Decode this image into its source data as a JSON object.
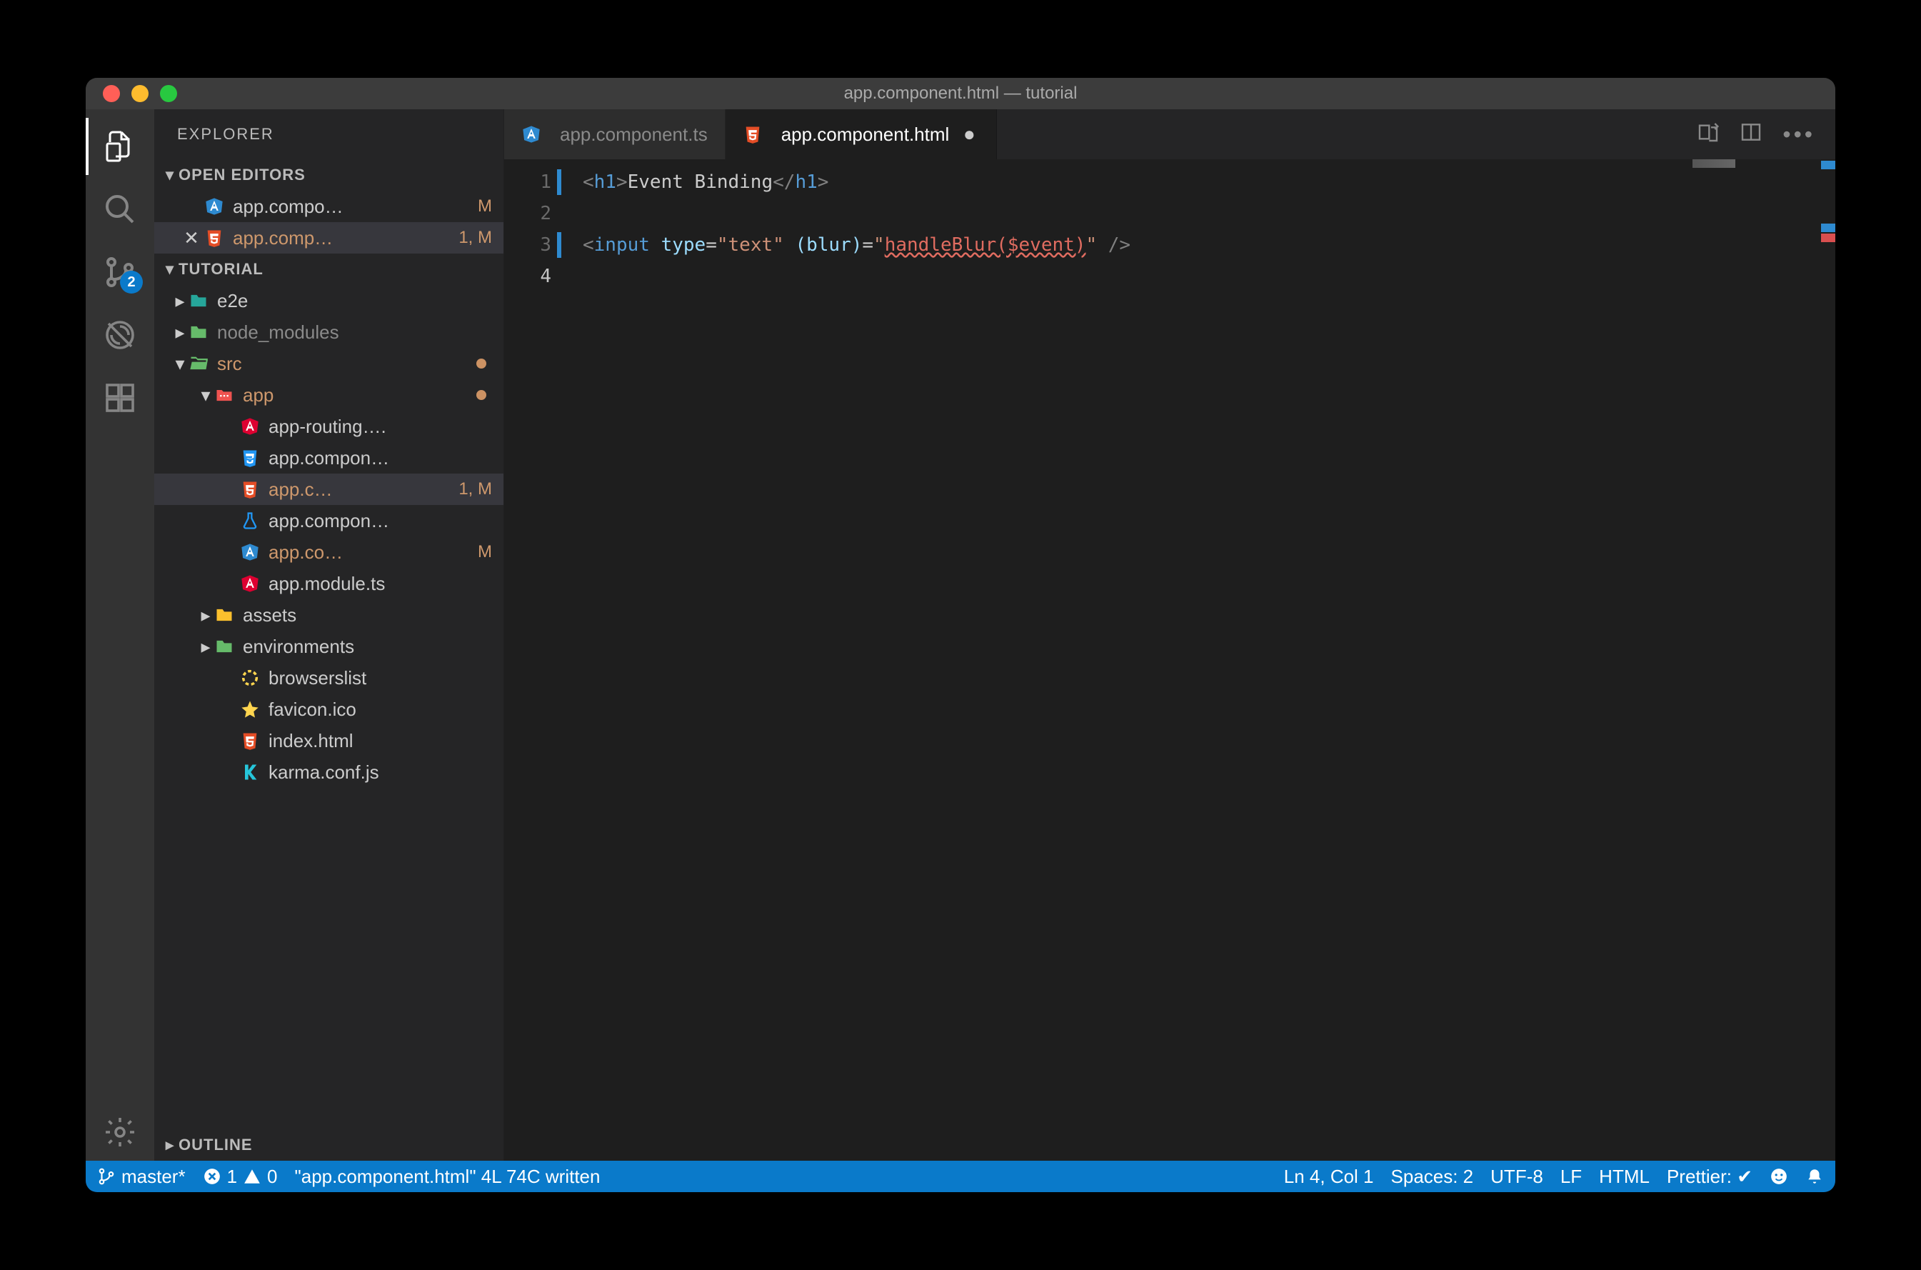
{
  "window": {
    "title": "app.component.html — tutorial"
  },
  "activity": {
    "scm_badge": "2"
  },
  "sidebar": {
    "title": "EXPLORER",
    "sections": {
      "open_editors": "OPEN EDITORS",
      "workspace": "TUTORIAL",
      "outline": "OUTLINE"
    },
    "open_editors": [
      {
        "name": "app.compo…",
        "icon": "angular",
        "badge": "M",
        "active": false
      },
      {
        "name": "app.comp…",
        "icon": "html",
        "badge": "1, M",
        "active": true
      }
    ],
    "tree": [
      {
        "indent": 0,
        "chev": "▸",
        "icon": "folder-teal",
        "label": "e2e"
      },
      {
        "indent": 0,
        "chev": "▸",
        "icon": "folder-dim",
        "label": "node_modules",
        "dim": true
      },
      {
        "indent": 0,
        "chev": "▾",
        "icon": "folder-open",
        "label": "src",
        "mod_dot": true,
        "mod": true
      },
      {
        "indent": 1,
        "chev": "▾",
        "icon": "folder-red",
        "label": "app",
        "mod_dot": true,
        "mod": true
      },
      {
        "indent": 2,
        "icon": "angular",
        "label": "app-routing…."
      },
      {
        "indent": 2,
        "icon": "css",
        "label": "app.compon…"
      },
      {
        "indent": 2,
        "icon": "html",
        "label": "app.c…",
        "badge": "1, M",
        "mod": true,
        "selected": true
      },
      {
        "indent": 2,
        "icon": "flask",
        "label": "app.compon…"
      },
      {
        "indent": 2,
        "icon": "angular-blue",
        "label": "app.co…",
        "badge": "M",
        "mod": true
      },
      {
        "indent": 2,
        "icon": "angular",
        "label": "app.module.ts"
      },
      {
        "indent": 1,
        "chev": "▸",
        "icon": "folder-yellow",
        "label": "assets"
      },
      {
        "indent": 1,
        "chev": "▸",
        "icon": "folder-green",
        "label": "environments"
      },
      {
        "indent": 2,
        "icon": "ring",
        "label": "browserslist"
      },
      {
        "indent": 2,
        "icon": "star",
        "label": "favicon.ico"
      },
      {
        "indent": 2,
        "icon": "html",
        "label": "index.html"
      },
      {
        "indent": 2,
        "icon": "karma",
        "label": "karma.conf.js"
      }
    ]
  },
  "tabs": [
    {
      "icon": "angular-blue",
      "label": "app.component.ts",
      "active": false,
      "close": false
    },
    {
      "icon": "html",
      "label": "app.component.html",
      "active": true,
      "close": true
    }
  ],
  "editor": {
    "lines": [
      "1",
      "2",
      "3",
      "4"
    ],
    "code": {
      "l1_tag_open": "<h1>",
      "l1_text": "Event Binding",
      "l1_tag_close": "</h1>",
      "l3_open": "<",
      "l3_tag": "input",
      "l3_attr1": "type",
      "l3_eq": "=",
      "l3_val1": "\"text\"",
      "l3_attr2": "(blur)",
      "l3_val2_q": "\"",
      "l3_val2_err": "handleBlur($event)",
      "l3_close": " />"
    }
  },
  "status": {
    "branch": "master*",
    "errors": "1",
    "warnings": "0",
    "msg": "\"app.component.html\" 4L 74C written",
    "cursor": "Ln 4, Col 1",
    "spaces": "Spaces: 2",
    "encoding": "UTF-8",
    "eol": "LF",
    "lang": "HTML",
    "prettier": "Prettier: ✔"
  }
}
